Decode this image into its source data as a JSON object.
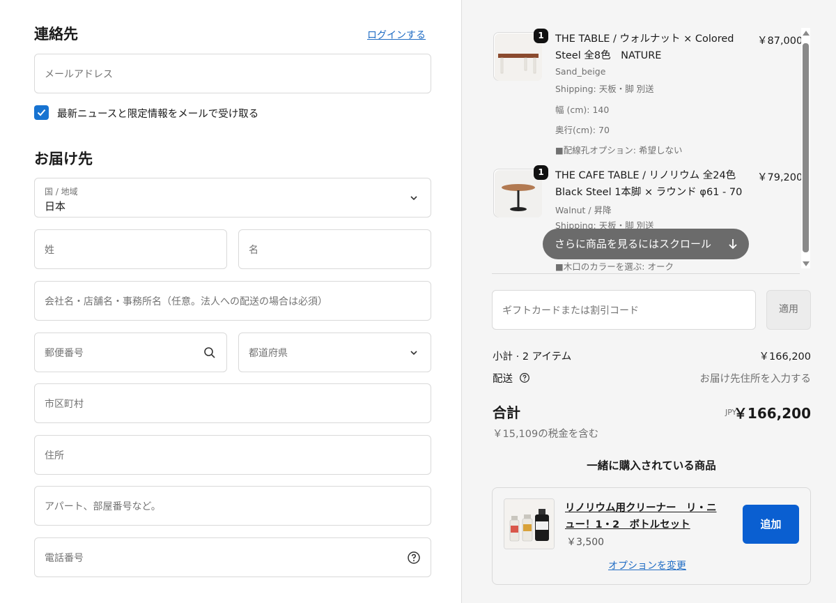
{
  "contact": {
    "heading": "連絡先",
    "login_link": "ログインする",
    "email_placeholder": "メールアドレス",
    "newsletter_label": "最新ニュースと限定情報をメールで受け取る",
    "newsletter_checked": true
  },
  "delivery": {
    "heading": "お届け先",
    "country_label": "国 / 地域",
    "country_value": "日本",
    "last_name_placeholder": "姓",
    "first_name_placeholder": "名",
    "company_placeholder": "会社名・店舗名・事務所名（任意。法人への配送の場合は必須）",
    "postal_placeholder": "郵便番号",
    "prefecture_placeholder": "都道府県",
    "city_placeholder": "市区町村",
    "address_placeholder": "住所",
    "apartment_placeholder": "アパート、部屋番号など。",
    "phone_placeholder": "電話番号"
  },
  "cart": {
    "items": [
      {
        "qty": "1",
        "name_line1": "THE TABLE / ウォルナット × Colored",
        "name_line2": "Steel 全8色　NATURE",
        "price": "￥87,000",
        "variant": "Sand_beige",
        "shipping": "Shipping: 天板・脚 別送",
        "width": "幅 (cm): 140",
        "depth": "奥行(cm): 70",
        "option": "■配線孔オプション: 希望しない"
      },
      {
        "qty": "1",
        "name_line1": "THE CAFE TABLE / リノリウム 全24色",
        "name_line2": "Black Steel 1本脚 × ラウンド φ61 - 70",
        "price": "￥79,200",
        "variant": "Walnut / 昇降",
        "shipping": "Shipping: 天板・脚 別送",
        "option": "■木口のカラーを選ぶ: オーク"
      }
    ],
    "scroll_hint": "さらに商品を見るにはスクロール"
  },
  "discount": {
    "placeholder": "ギフトカードまたは割引コード",
    "apply_label": "適用"
  },
  "summary": {
    "subtotal_label": "小計 · 2 アイテム",
    "subtotal_value": "￥166,200",
    "shipping_label": "配送",
    "shipping_value": "お届け先住所を入力する",
    "total_label": "合計",
    "currency": "JPY",
    "total_value": "￥166,200",
    "tax_note": "￥15,109の税金を含む"
  },
  "upsell": {
    "heading": "一緒に購入されている商品",
    "product_line1": "リノリウム用クリーナー　リ・ニ",
    "product_line2": "ュー！1・2　ボトルセット",
    "price": "￥3,500",
    "add_label": "追加",
    "options_link": "オプションを変更"
  },
  "colors": {
    "accent": "#1773d1",
    "button": "#0a5fd1",
    "link": "#1f6cc4"
  }
}
